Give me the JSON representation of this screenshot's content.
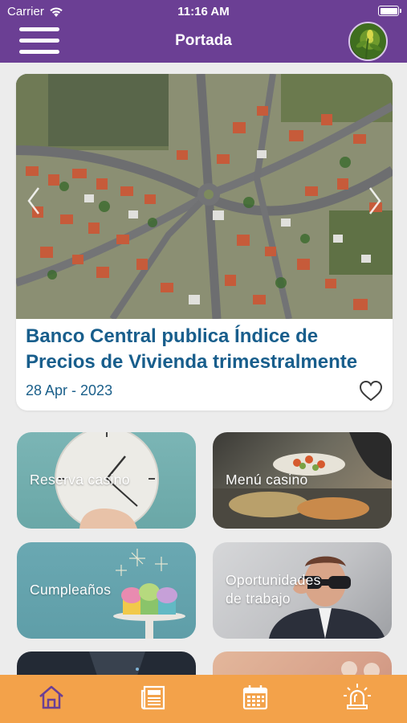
{
  "status_bar": {
    "carrier": "Carrier",
    "time": "11:16 AM"
  },
  "header": {
    "title": "Portada",
    "menu_icon": "hamburger-menu-icon",
    "avatar": "user-avatar"
  },
  "news": {
    "title": "Banco Central publica Índice de Precios de Vivienda trimestralmente",
    "date": "28 Apr - 2023",
    "image": "aerial-city-photo",
    "favorite_icon": "heart-outline-icon"
  },
  "tiles": [
    {
      "label": "Reserva casino",
      "image": "clock-hand-photo"
    },
    {
      "label": "Menú casino",
      "image": "buffet-food-photo"
    },
    {
      "label": "Cumpleaños",
      "image": "cupcakes-photo"
    },
    {
      "label": "Oportunidades de trabajo",
      "image": "businessman-binoculars-photo"
    }
  ],
  "tabbar": {
    "items": [
      "home-icon",
      "newspaper-icon",
      "calendar-icon",
      "alert-siren-icon"
    ],
    "active": "home-icon"
  },
  "colors": {
    "header_bg": "#6b3f94",
    "tabbar_bg": "#f3a24a",
    "title_blue": "#185e8c",
    "tab_active": "#6b3f94"
  }
}
